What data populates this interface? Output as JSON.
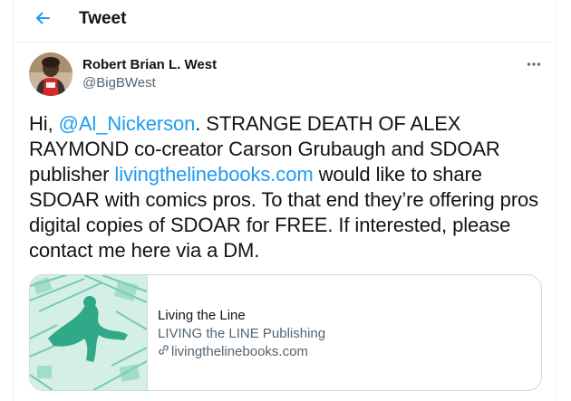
{
  "header": {
    "title": "Tweet",
    "back_icon": "arrow-left-icon"
  },
  "tweet": {
    "author": {
      "name": "Robert Brian L. West",
      "handle": "@BigBWest",
      "avatar_icon": "avatar"
    },
    "more_icon": "more-horizontal-icon",
    "text": {
      "part1": "Hi, ",
      "mention": "@Al_Nickerson",
      "part2": ". STRANGE DEATH OF ALEX RAYMOND co-creator Carson Grubaugh and SDOAR publisher ",
      "link": "livingthelinebooks.com",
      "part3": " would like to share SDOAR with comics pros. To that end they’re offering pros digital copies of SDOAR for FREE. If interested, please contact me here via a DM."
    },
    "card": {
      "title": "Living the Line",
      "description": "LIVING the LINE Publishing",
      "domain": "livingthelinebooks.com",
      "domain_icon": "link-icon"
    }
  },
  "colors": {
    "accent": "#1d9bf0",
    "secondary_text": "#536471",
    "border": "#cfd9de"
  }
}
